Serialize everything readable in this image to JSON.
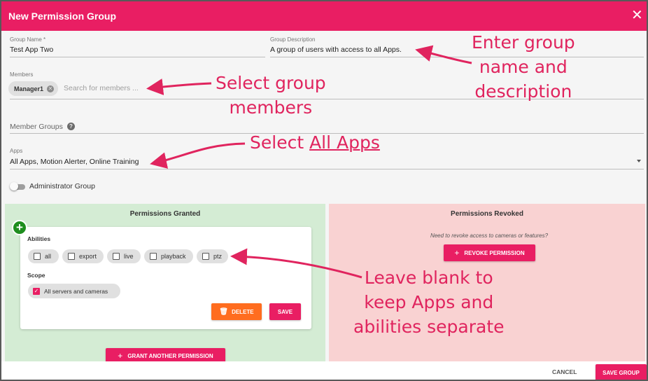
{
  "dialog": {
    "title": "New Permission Group",
    "close_glyph": "✕",
    "accent_color": "#e91e63"
  },
  "form": {
    "group_name_label": "Group Name *",
    "group_name_value": "Test App Two",
    "group_description_label": "Group Description",
    "group_description_value": "A group of users with access to all Apps.",
    "members_label": "Members",
    "member_chip": "Manager1",
    "members_search_placeholder": "Search for members ...",
    "member_groups_label": "Member Groups",
    "apps_label": "Apps",
    "apps_value": "All Apps, Motion Alerter, Online Training",
    "administrator_group_label": "Administrator Group",
    "administrator_group_on": false
  },
  "permissions_granted": {
    "title": "Permissions Granted",
    "abilities_heading": "Abilities",
    "abilities": [
      {
        "label": "all",
        "checked": false
      },
      {
        "label": "export",
        "checked": false
      },
      {
        "label": "live",
        "checked": false
      },
      {
        "label": "playback",
        "checked": false
      },
      {
        "label": "ptz",
        "checked": false
      }
    ],
    "scope_heading": "Scope",
    "scope": {
      "label": "All servers and cameras",
      "checked": true
    },
    "delete_label": "DELETE",
    "save_label": "SAVE",
    "grant_another_label": "GRANT ANOTHER PERMISSION",
    "panel_color": "#d4ecd4"
  },
  "permissions_revoked": {
    "title": "Permissions Revoked",
    "hint": "Need to revoke access to cameras or features?",
    "revoke_label": "REVOKE PERMISSION",
    "panel_color": "#f9d2d2"
  },
  "footer": {
    "cancel_label": "CANCEL",
    "save_group_label": "SAVE GROUP"
  },
  "annotations": {
    "name_description": [
      "Enter group",
      "name and",
      "description"
    ],
    "members": [
      "Select group",
      "members"
    ],
    "apps_prefix": "Select ",
    "apps_link": "All Apps",
    "blank": [
      "Leave blank to",
      "keep Apps and",
      "abilities separate"
    ]
  }
}
